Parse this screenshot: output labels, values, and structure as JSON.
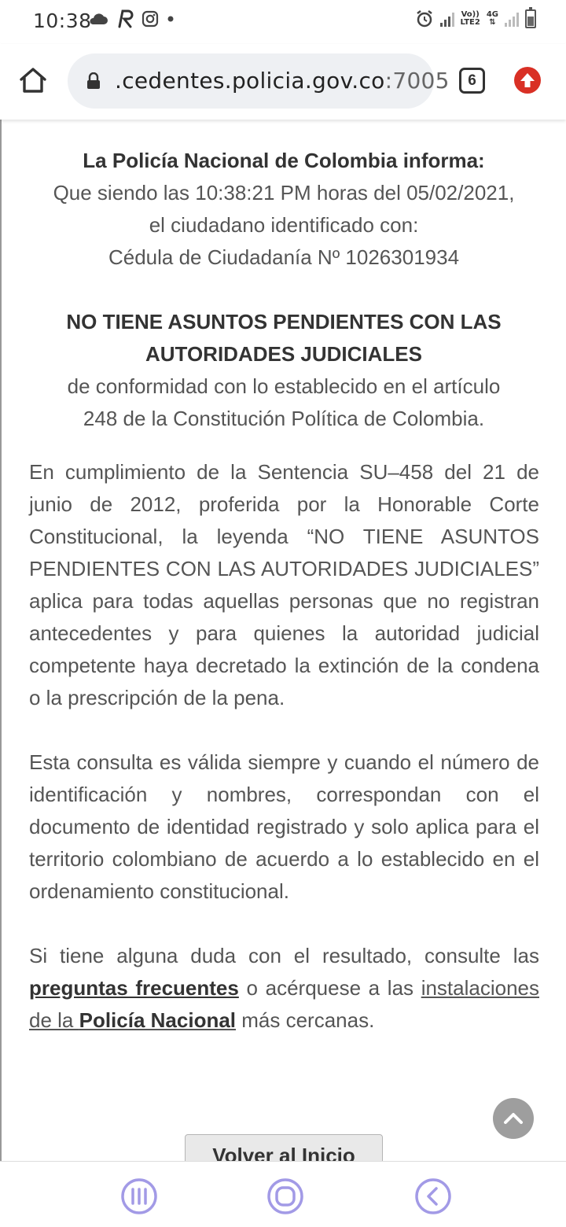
{
  "status_bar": {
    "time": "10:38",
    "left_icons": [
      "cloud-icon",
      "r-app-icon",
      "instagram-icon",
      "dot-icon"
    ],
    "right_icons": [
      "alarm-icon",
      "signal-icon",
      "volte-icon",
      "4g-icon",
      "signal-icon",
      "battery-icon"
    ],
    "volte_line1": "Vo))",
    "volte_line2": "LTE2",
    "net_label": "4G"
  },
  "toolbar": {
    "url_main": "cedentes.policia.gov.co",
    "url_port": ":7005",
    "url_prefix": ".",
    "tab_count": "6"
  },
  "content": {
    "heading": "La Policía Nacional de Colombia informa:",
    "line1": "Que siendo las 10:38:21 PM horas del 05/02/2021,",
    "line2": "el ciudadano identificado con:",
    "line3": "Cédula de Ciudadanía Nº 1026301934",
    "status_heading": "NO TIENE ASUNTOS PENDIENTES CON LAS AUTORIDADES JUDICIALES",
    "status_sub1": "de conformidad con lo establecido en el artículo",
    "status_sub2": "248 de la Constitución Política de Colombia.",
    "para1": "En cumplimiento de la Sentencia SU–458 del 21 de junio de 2012, proferida por la Honorable Corte Constitucional, la leyenda “NO TIENE ASUNTOS PENDIENTES CON LAS AUTORIDADES JUDICIALES” aplica para todas aquellas personas que no registran antecedentes y para quienes la autoridad judicial competente haya decretado la extinción de la condena o la prescripción de la pena.",
    "para2": "Esta consulta es válida siempre y cuando el número de identificación y nombres, correspondan con el documento de identidad registrado y solo aplica para el territorio colombiano de acuerdo a lo establecido en el ordenamiento constitucional.",
    "para3_start": "Si tiene alguna duda con el resultado, consulte las ",
    "para3_link1": "preguntas frecuentes",
    "para3_mid": " o acérquese a las ",
    "para3_link2_plain": "instalaciones de la ",
    "para3_link2_bold": "Policía Nacional",
    "para3_end": " más cercanas.",
    "back_button": "Volver al Inicio"
  },
  "nav_bar": {
    "items": [
      "recent-apps",
      "home",
      "back"
    ]
  },
  "colors": {
    "update_red": "#d93025",
    "nav_purple": "#a29ae6",
    "scroll_btn_gray": "#9e9e9e"
  }
}
